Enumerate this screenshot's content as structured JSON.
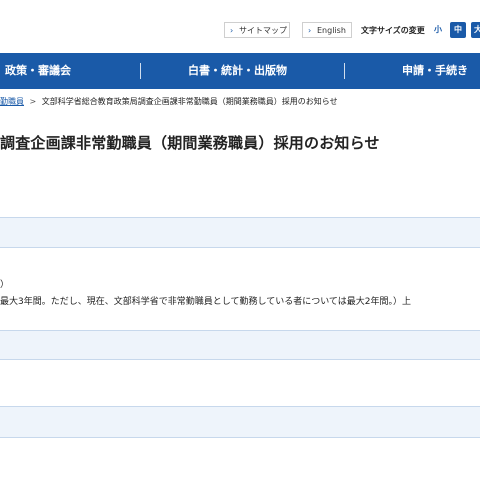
{
  "header": {
    "sitemap_label": "サイトマップ",
    "english_label": "English",
    "fontsize_label": "文字サイズの変更",
    "fontsize_small": "小",
    "fontsize_medium": "中",
    "fontsize_large": "大",
    "accent_color": "#1a5aa8"
  },
  "global_nav": {
    "items": [
      {
        "label": "政策・審議会"
      },
      {
        "label": "白書・統計・出版物"
      },
      {
        "label": "申請・手続き"
      }
    ]
  },
  "breadcrumb": {
    "items": [
      {
        "label": "勤職員"
      },
      {
        "label": "文部科学省総合教育政策局調査企画課非常勤職員（期間業務職員）採用のお知らせ"
      }
    ]
  },
  "page": {
    "title": "調査企画課非常勤職員（期間業務職員）採用のお知らせ",
    "line1": "）",
    "line2": "最大3年間。ただし、現在、文部科学省で非常勤職員として勤務している者については最大2年間。）上"
  }
}
